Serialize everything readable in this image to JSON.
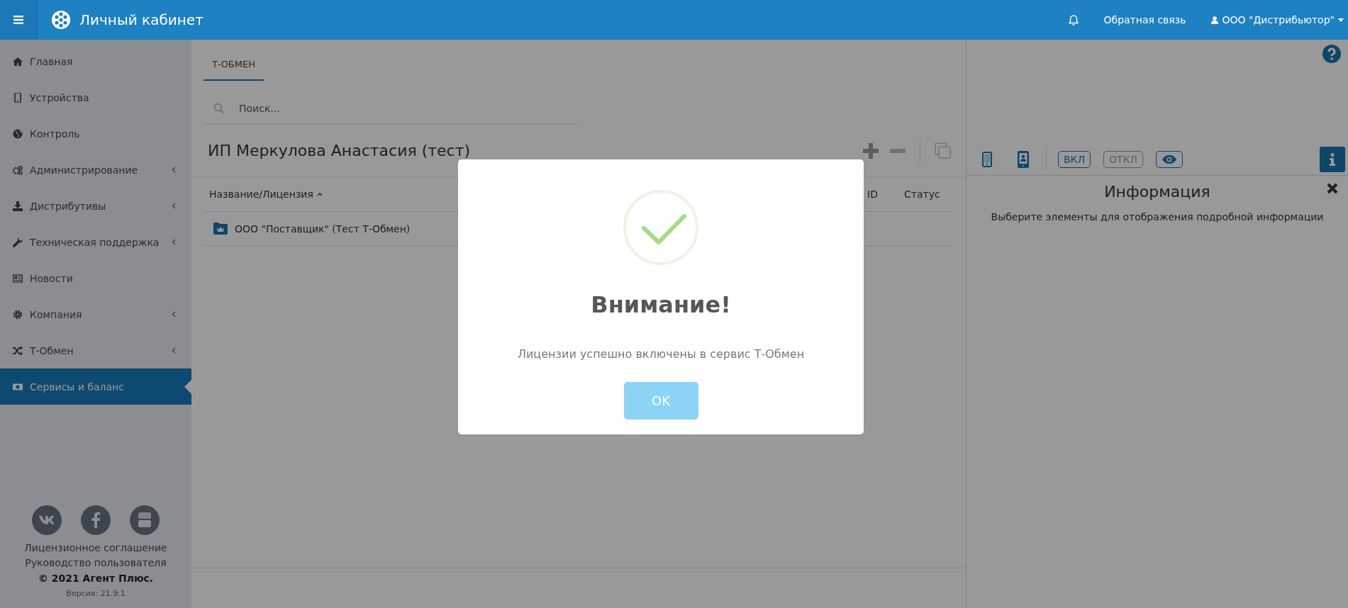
{
  "header": {
    "title": "Личный кабинет",
    "feedback": "Обратная связь",
    "user": "ООО \"Дистрибьютор\""
  },
  "sidebar": {
    "items": [
      {
        "label": "Главная",
        "submenu": false,
        "selected": false
      },
      {
        "label": "Устройства",
        "submenu": false,
        "selected": false
      },
      {
        "label": "Контроль",
        "submenu": false,
        "selected": false
      },
      {
        "label": "Администрирование",
        "submenu": true,
        "selected": false
      },
      {
        "label": "Дистрибутивы",
        "submenu": true,
        "selected": false
      },
      {
        "label": "Техническая поддержка",
        "submenu": true,
        "selected": false
      },
      {
        "label": "Новости",
        "submenu": false,
        "selected": false
      },
      {
        "label": "Компания",
        "submenu": true,
        "selected": false
      },
      {
        "label": "Т-Обмен",
        "submenu": true,
        "selected": false
      },
      {
        "label": "Сервисы и баланс",
        "submenu": false,
        "selected": true
      }
    ],
    "links": [
      "Лицензионное соглашение",
      "Руководство пользователя"
    ],
    "copyright": "© 2021 Агент Плюс.",
    "version": "Версия: 21.9.1"
  },
  "tabs": [
    {
      "label": "Т-ОБМЕН",
      "selected": true
    }
  ],
  "search": {
    "placeholder": "Поиск..."
  },
  "title": "ИП Меркулова Анастасия (тест)",
  "table": {
    "columns": [
      {
        "label": "Название/Лицензия",
        "sorted": true
      },
      {
        "label": "ID",
        "sorted": false
      },
      {
        "label": "Статус",
        "sorted": false
      }
    ],
    "rows": [
      {
        "name": "ООО \"Поставщик\" (Тест Т-Обмен)"
      }
    ]
  },
  "right_panel": {
    "toggles": [
      {
        "label": "ВКЛ",
        "disabled": false
      },
      {
        "label": "ОТКЛ",
        "disabled": true
      }
    ],
    "info_title": "Информация",
    "info_text": "Выберите элементы для отображения подробной информации"
  },
  "dialog": {
    "title": "Внимание!",
    "message": "Лицензии успешно включены в сервис Т-Обмен",
    "button": "OK"
  }
}
